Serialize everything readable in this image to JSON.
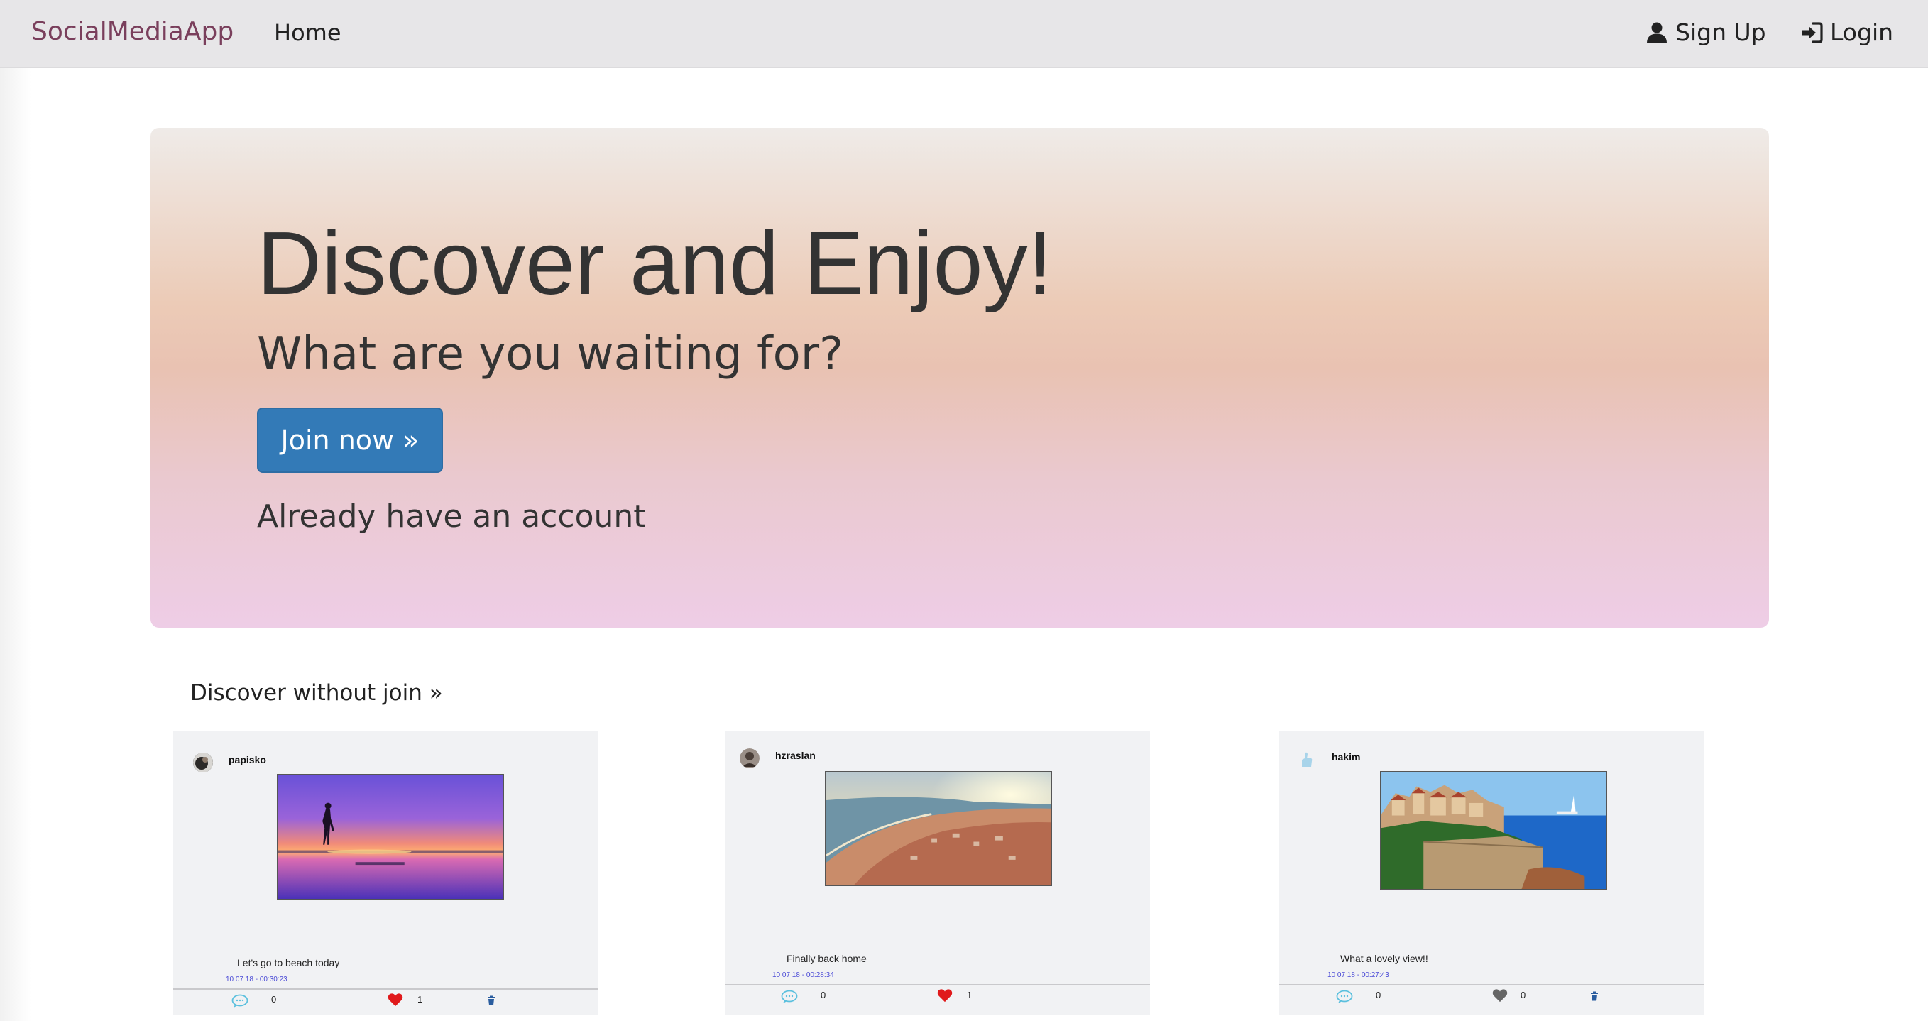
{
  "navbar": {
    "brand": "SocialMediaApp",
    "home": "Home",
    "signup": "Sign Up",
    "login": "Login",
    "signup_icon": "user-icon",
    "login_icon": "login-icon"
  },
  "hero": {
    "title": "Discover and Enjoy!",
    "subtitle": "What are you waiting for?",
    "join_button": "Join now »",
    "already": "Already have an account"
  },
  "discover_link": "Discover without join »",
  "colors": {
    "brand": "#7a3f5c",
    "button": "#337ab7",
    "liked_heart": "#e0191b",
    "unliked_heart": "#666666",
    "timestamp": "#4b4bd6",
    "comment_icon": "#5bc0de"
  },
  "posts": [
    {
      "username": "papisko",
      "caption": "Let's go to beach today",
      "timestamp": "10 07 18 - 00:30:23",
      "comments": "0",
      "likes": "1",
      "liked": true,
      "image": "sunset-beach-silhouette"
    },
    {
      "username": "hzraslan",
      "caption": "Finally back home",
      "timestamp": "10 07 18 - 00:28:34",
      "comments": "0",
      "likes": "1",
      "liked": true,
      "image": "coastal-city-sunset"
    },
    {
      "username": "hakim",
      "caption": "What a lovely view!!",
      "timestamp": "10 07 18 - 00:27:43",
      "comments": "0",
      "likes": "0",
      "liked": false,
      "image": "seaside-old-town"
    }
  ]
}
